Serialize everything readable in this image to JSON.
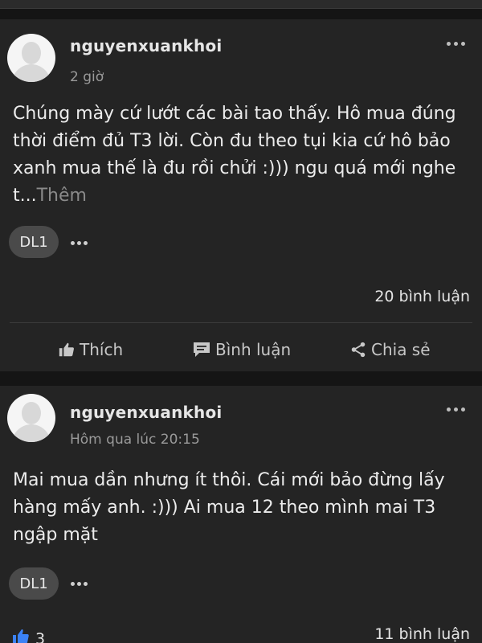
{
  "posts": [
    {
      "username": "nguyenxuankhoi",
      "time": "2 giờ",
      "text": "Chúng mày cứ lướt các bài tao thấy. Hô mua đúng thời điểm đủ T3 lời. Còn đu theo tụi kia cứ hô bảo xanh mua thế là đu rồi chửi :))) ngu quá mới nghe t...",
      "see_more": "Thêm",
      "chip": "DL1",
      "comments": "20 bình luận",
      "actions": {
        "like": "Thích",
        "comment": "Bình luận",
        "share": "Chia sẻ"
      },
      "icons": [
        "avatar-placeholder",
        "more-icon",
        "thumbs-up-icon",
        "comment-icon",
        "share-icon"
      ]
    },
    {
      "username": "nguyenxuankhoi",
      "time": "Hôm qua lúc 20:15",
      "text": "Mai mua dần nhưng ít thôi. Cái mới bảo đừng lấy hàng mấy anh. :))) Ai mua 12 theo mình mai T3 ngập mặt",
      "chip": "DL1",
      "likes": "3",
      "comments": "11 bình luận",
      "icons": [
        "avatar-placeholder",
        "more-icon",
        "thumbs-up-icon"
      ]
    }
  ],
  "colors": {
    "background": "#151515",
    "card": "#242424",
    "text": "#ececec",
    "muted": "#9a9a9a",
    "like_blue": "#3b82f6"
  }
}
